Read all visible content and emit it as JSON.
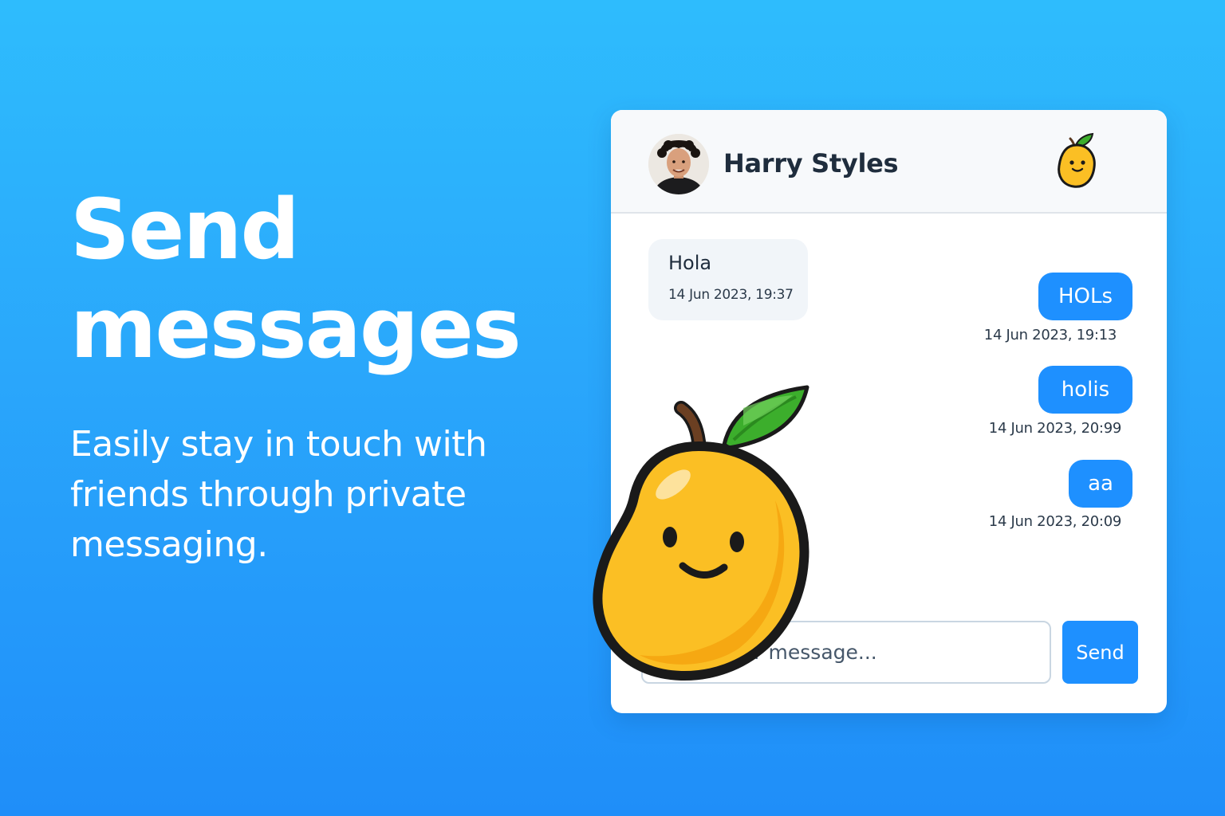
{
  "hero": {
    "title_line1": "Send",
    "title_line2": "messages",
    "subtitle_line1": "Easily stay in touch with",
    "subtitle_line2": "friends through private",
    "subtitle_line3": "messaging."
  },
  "chat": {
    "contact_name": "Harry Styles",
    "avatar_icon": "user-avatar",
    "logo_icon": "mango-logo-icon",
    "messages": [
      {
        "direction": "incoming",
        "text": "Hola",
        "time": "14 Jun 2023, 19:37"
      },
      {
        "direction": "outgoing",
        "text": "HOLs",
        "time": "14 Jun 2023, 19:13"
      },
      {
        "direction": "outgoing",
        "text": "holis",
        "time": "14 Jun 2023, 20:99"
      },
      {
        "direction": "outgoing",
        "text": "aa",
        "time": "14 Jun 2023, 20:09"
      }
    ],
    "composer": {
      "placeholder": "Type your message...",
      "send_label": "Send"
    }
  },
  "colors": {
    "background_top": "#2ebcfd",
    "background_bottom": "#1f8ef9",
    "accent": "#1e90ff",
    "incoming_bubble": "#f1f5f9",
    "mango": "#fbbf24",
    "leaf": "#3cae2c"
  }
}
